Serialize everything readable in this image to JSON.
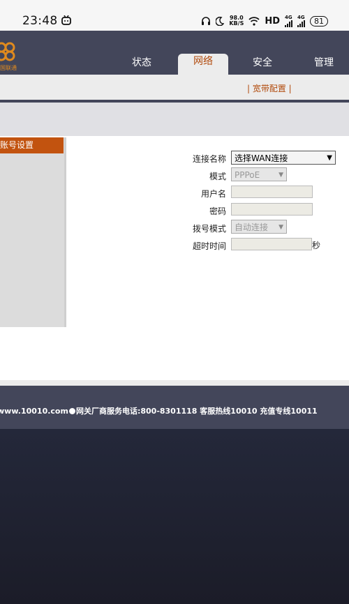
{
  "status_bar": {
    "time": "23:48",
    "speed_value": "98.0",
    "speed_unit": "KB/S",
    "hd_label": "HD",
    "net1": "4G",
    "net2": "4G",
    "battery": "81"
  },
  "header": {
    "logo_text": "国联通",
    "tabs": [
      {
        "label": "状态"
      },
      {
        "label": "网络"
      },
      {
        "label": "安全"
      },
      {
        "label": "管理"
      }
    ],
    "active_tab": "网络",
    "subnav": {
      "label": "| 宽带配置 |"
    }
  },
  "sidebar": {
    "active_item": "账号设置"
  },
  "form": {
    "connection_name_label": "连接名称",
    "connection_name_value": "选择WAN连接",
    "mode_label": "模式",
    "mode_value": "PPPoE",
    "username_label": "用户名",
    "username_value": "",
    "password_label": "密码",
    "password_value": "",
    "dial_mode_label": "拨号模式",
    "dial_mode_value": "自动连接",
    "timeout_label": "超时时间",
    "timeout_value": "",
    "timeout_unit": "秒"
  },
  "footer": {
    "text_part1": "www.10010.com",
    "text_part2": "网关厂商服务电话:800-8301118 客服热线10010 充值专线10011"
  },
  "colors": {
    "header_bg": "#43465a",
    "accent": "#c2530f",
    "active_tab_text": "#b14a0c"
  }
}
